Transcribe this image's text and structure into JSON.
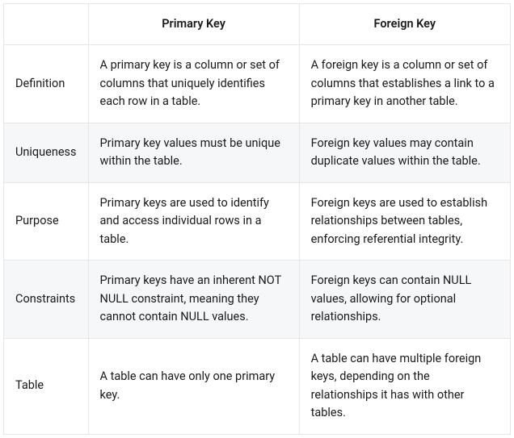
{
  "headers": {
    "corner": "",
    "primary": "Primary Key",
    "foreign": "Foreign Key"
  },
  "rows": [
    {
      "label": "Definition",
      "primary": "A primary key is a column or set of columns that uniquely identifies each row in a table.",
      "foreign": "A foreign key is a column or set of columns that establishes a link to a primary key in another table."
    },
    {
      "label": "Uniqueness",
      "primary": "Primary key values must be unique within the table.",
      "foreign": "Foreign key values may contain duplicate values within the table."
    },
    {
      "label": "Purpose",
      "primary": "Primary keys are used to identify and access individual rows in a table.",
      "foreign": "Foreign keys are used to establish relationships between tables, enforcing referential integrity."
    },
    {
      "label": "Constraints",
      "primary": "Primary keys have an inherent NOT NULL constraint, meaning they cannot contain NULL values.",
      "foreign": "Foreign keys can contain NULL values, allowing for optional relationships."
    },
    {
      "label": "Table",
      "primary": "A table can have only one primary key.",
      "foreign": "A table can have multiple foreign keys, depending on the relationships it has with other tables."
    }
  ]
}
